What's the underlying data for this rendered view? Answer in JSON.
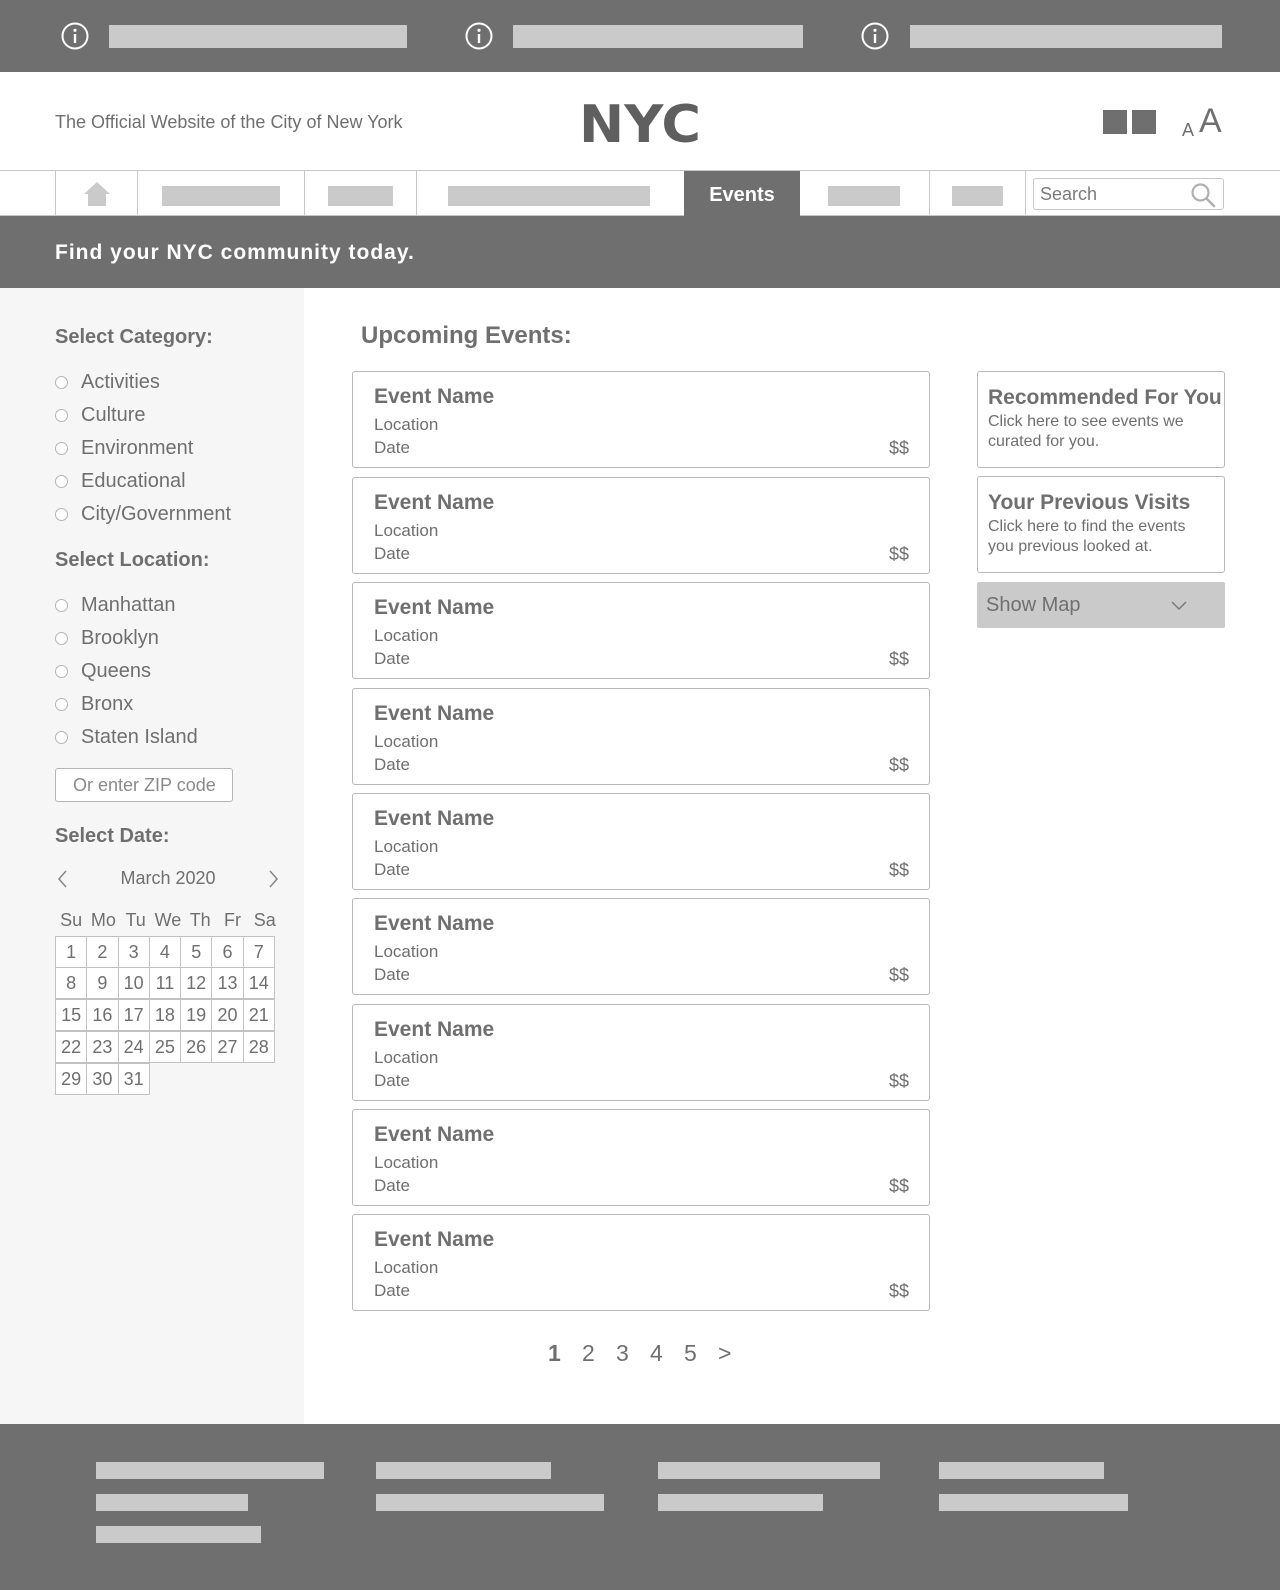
{
  "header": {
    "tagline": "The Official Website of the City of New York",
    "logo_text": "NYC",
    "font_small": "A",
    "font_large": "A"
  },
  "nav": {
    "active_label": "Events",
    "search_placeholder": "Search"
  },
  "banner": {
    "text": "Find your NYC community today."
  },
  "sidebar": {
    "category_heading": "Select Category:",
    "categories": [
      "Activities",
      "Culture",
      "Environment",
      "Educational",
      "City/Government"
    ],
    "location_heading": "Select Location:",
    "locations": [
      "Manhattan",
      "Brooklyn",
      "Queens",
      "Bronx",
      "Staten Island"
    ],
    "zip_placeholder": "Or enter ZIP code",
    "date_heading": "Select Date:",
    "calendar": {
      "month": "March 2020",
      "weekdays": [
        "Su",
        "Mo",
        "Tu",
        "We",
        "Th",
        "Fr",
        "Sa"
      ],
      "weeks": [
        [
          "1",
          "2",
          "3",
          "4",
          "5",
          "6",
          "7"
        ],
        [
          "8",
          "9",
          "10",
          "11",
          "12",
          "13",
          "14"
        ],
        [
          "15",
          "16",
          "17",
          "18",
          "19",
          "20",
          "21"
        ],
        [
          "22",
          "23",
          "24",
          "25",
          "26",
          "27",
          "28"
        ],
        [
          "29",
          "30",
          "31"
        ]
      ]
    }
  },
  "main": {
    "title": "Upcoming Events:",
    "events": [
      {
        "name": "Event Name",
        "location": "Location",
        "date": "Date",
        "price": "$$"
      },
      {
        "name": "Event Name",
        "location": "Location",
        "date": "Date",
        "price": "$$"
      },
      {
        "name": "Event Name",
        "location": "Location",
        "date": "Date",
        "price": "$$"
      },
      {
        "name": "Event Name",
        "location": "Location",
        "date": "Date",
        "price": "$$"
      },
      {
        "name": "Event Name",
        "location": "Location",
        "date": "Date",
        "price": "$$"
      },
      {
        "name": "Event Name",
        "location": "Location",
        "date": "Date",
        "price": "$$"
      },
      {
        "name": "Event Name",
        "location": "Location",
        "date": "Date",
        "price": "$$"
      },
      {
        "name": "Event Name",
        "location": "Location",
        "date": "Date",
        "price": "$$"
      },
      {
        "name": "Event Name",
        "location": "Location",
        "date": "Date",
        "price": "$$"
      }
    ],
    "pagination": {
      "pages": [
        "1",
        "2",
        "3",
        "4",
        "5"
      ],
      "current": "1",
      "next": ">"
    }
  },
  "aside": {
    "recommended_title": "Recommended For You",
    "recommended_desc": "Click here to see events we curated for you.",
    "previous_title": "Your Previous Visits",
    "previous_desc": "Click here to find the events you previous looked at.",
    "map_label": "Show Map"
  },
  "colors": {
    "dark_gray": "#6f6f6f",
    "placeholder_gray": "#cacaca",
    "sidebar_bg": "#f6f6f6",
    "border": "#c8c8c8"
  }
}
